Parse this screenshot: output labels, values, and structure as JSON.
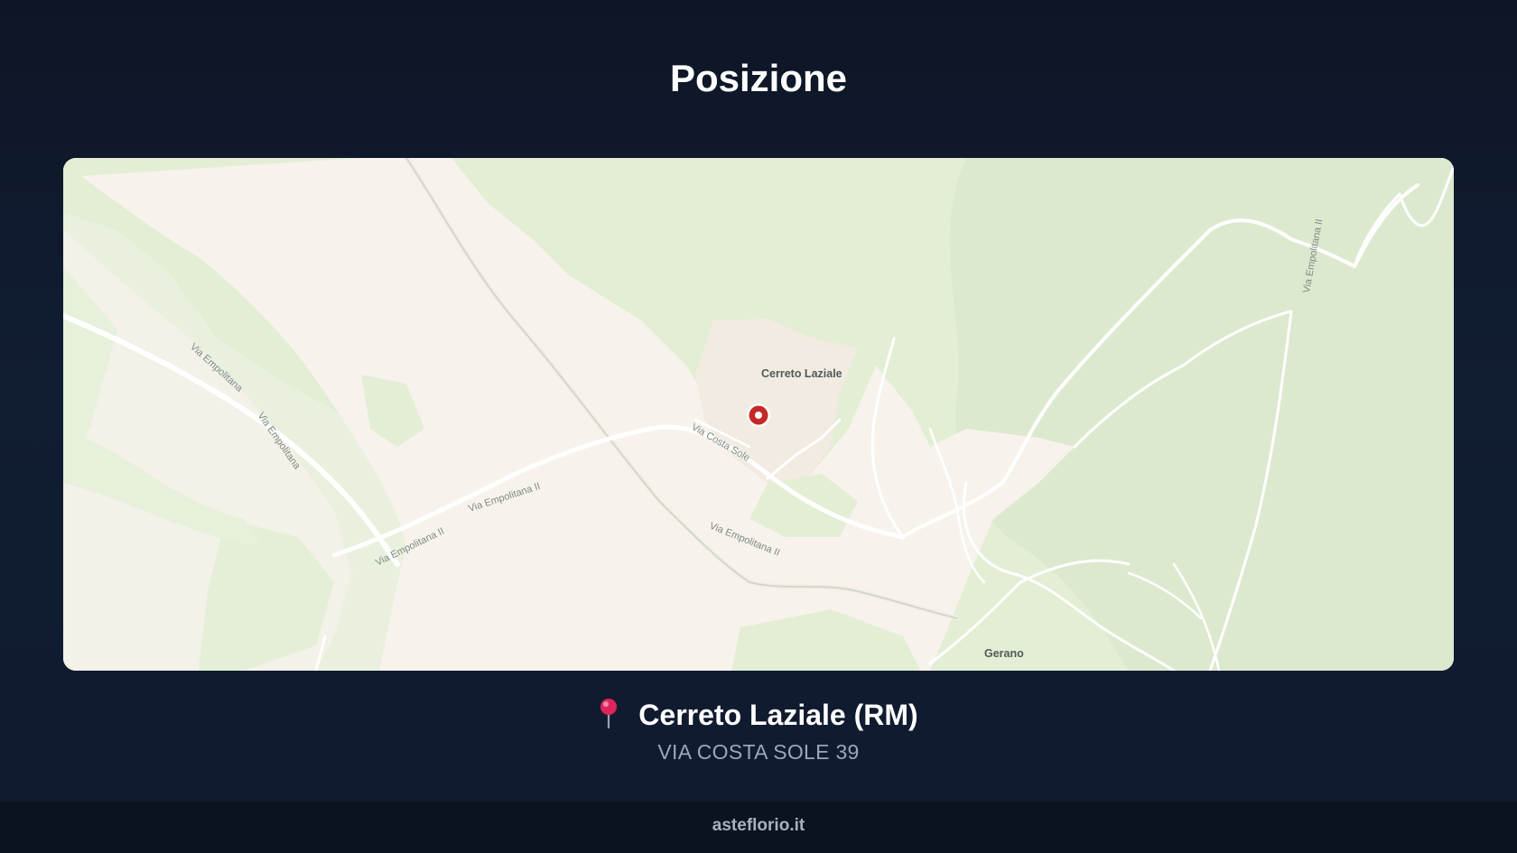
{
  "header": {
    "title": "Posizione"
  },
  "map": {
    "place_labels": {
      "cerreto": "Cerreto Laziale",
      "gerano": "Gerano"
    },
    "road_labels": {
      "empolitana_1": "Via Empolitana",
      "empolitana_2": "Via Empolitana",
      "empolitana_ii_1": "Via Empolitana II",
      "empolitana_ii_2": "Via Empolitana II",
      "empolitana_ii_3": "Via Empolitana II",
      "empolitana_ii_4": "Via Empolitana II",
      "costa_sole": "Via Costa Sole"
    },
    "marker_icon": "map-marker-icon",
    "colors": {
      "forest": "#e6f0d8",
      "urban": "#f8f5ef",
      "marker": "#c62828"
    }
  },
  "location": {
    "pin_icon": "round-pushpin-icon",
    "city": "Cerreto Laziale (RM)",
    "address": "VIA COSTA SOLE 39"
  },
  "footer": {
    "site": "asteflorio.it"
  }
}
